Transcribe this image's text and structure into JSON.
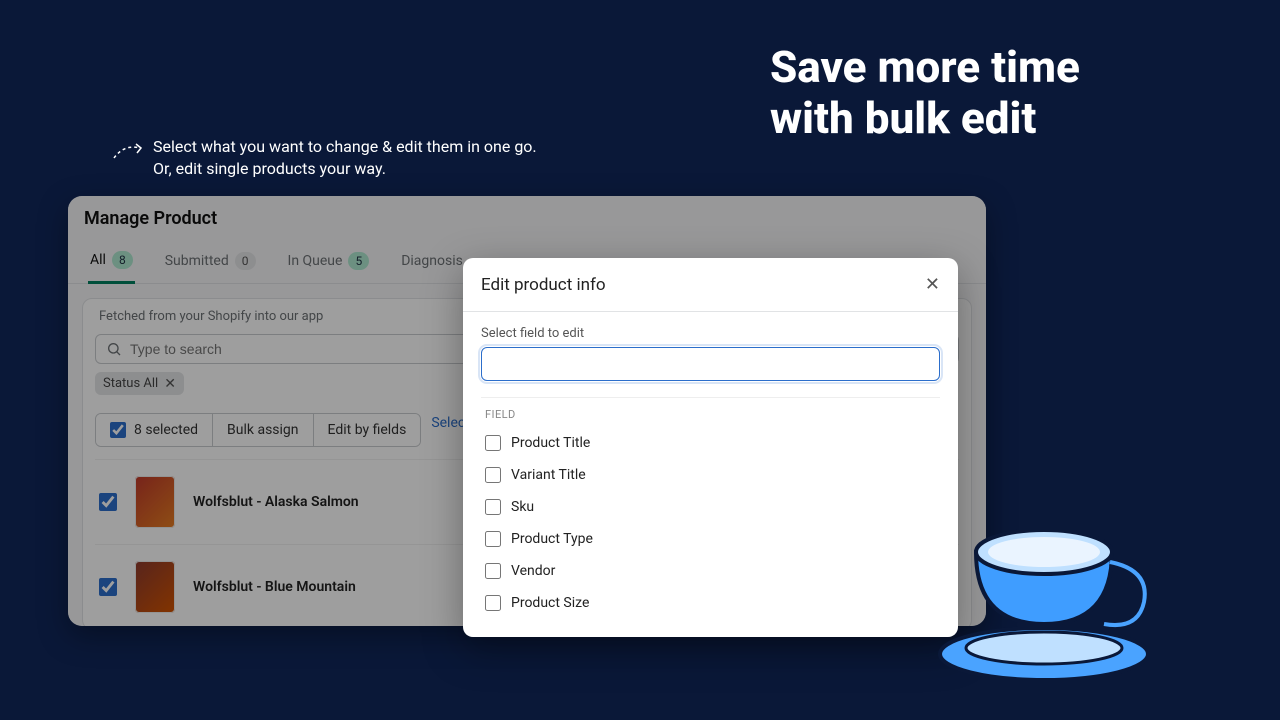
{
  "hero": {
    "line1": "Save more time",
    "line2": "with bulk edit"
  },
  "sub": {
    "line1": "Select what you want to change & edit them in one go.",
    "line2": "Or, edit single products your way."
  },
  "app": {
    "title": "Manage Product",
    "tabs": [
      {
        "label": "All",
        "count": "8",
        "badge": "green",
        "active": true
      },
      {
        "label": "Submitted",
        "count": "0",
        "badge": "gray"
      },
      {
        "label": "In Queue",
        "count": "5",
        "badge": "green"
      },
      {
        "label": "Diagnosis"
      }
    ],
    "helper": "Fetched from your Shopify into our app",
    "search_placeholder": "Type to search",
    "filter_chip": "Status All",
    "selected_label": "8 selected",
    "bulk_assign": "Bulk assign",
    "edit_by_fields": "Edit by fields",
    "select_all": "Select all products",
    "rows": [
      {
        "name": "Wolfsblut - Alaska Salmon"
      },
      {
        "name": "Wolfsblut - Blue Mountain"
      }
    ]
  },
  "modal": {
    "title": "Edit product info",
    "label": "Select field to edit",
    "group": "FIELD",
    "options": [
      "Product Title",
      "Variant Title",
      "Sku",
      "Product Type",
      "Vendor",
      "Product Size"
    ]
  }
}
